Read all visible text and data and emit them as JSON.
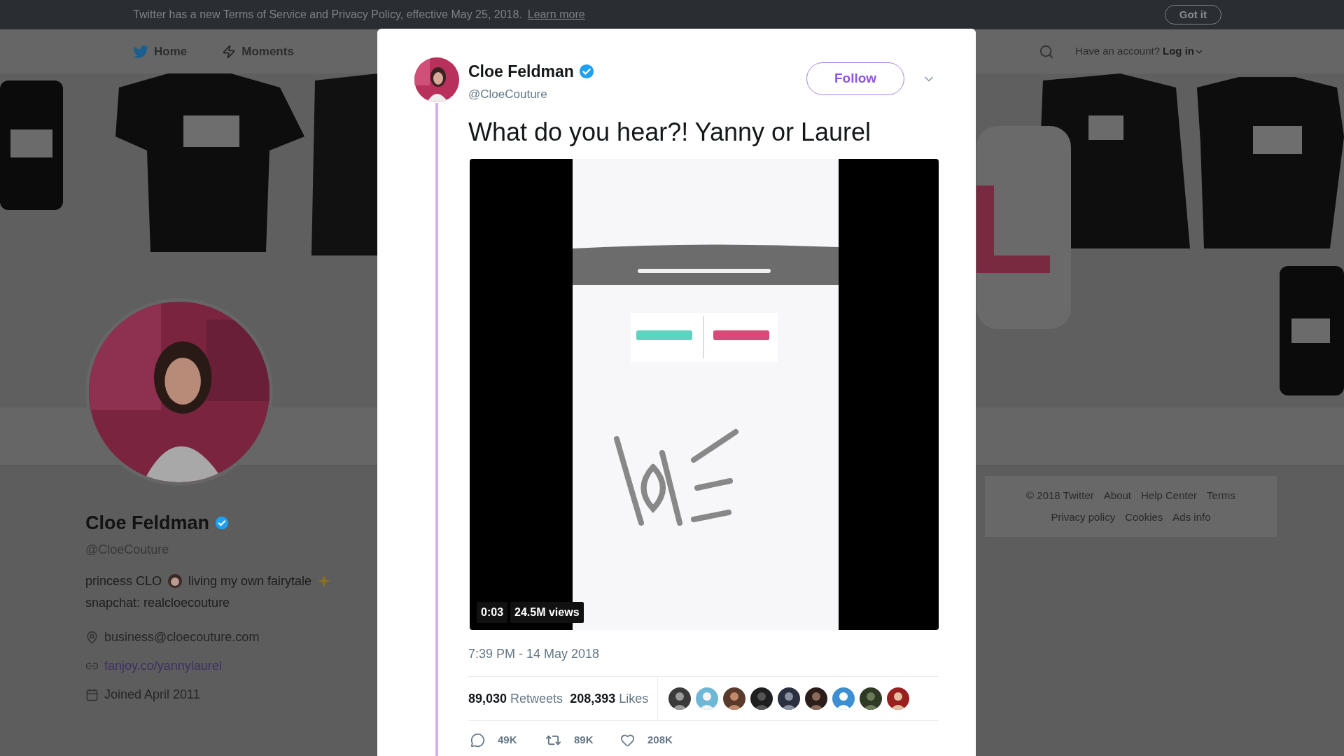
{
  "notice_banner": {
    "text": "Twitter has a new Terms of Service and Privacy Policy, effective May 25, 2018.",
    "link": "Learn more",
    "button": "Got it"
  },
  "nav": {
    "items": [
      {
        "label": "Home",
        "kind": "home"
      },
      {
        "label": "Moments",
        "kind": "moments"
      }
    ],
    "account_prompt": "Have an account?",
    "login": "Log in"
  },
  "profile": {
    "name": "Cloe Feldman",
    "verified": true,
    "handle": "@CloeCouture",
    "bio": {
      "line_1": [
        "princess CLO",
        "living my own fairytale"
      ],
      "line_2": "snapchat: realcloecouture"
    },
    "details": [
      {
        "kind": "location",
        "text": "business@cloecouture.com"
      },
      {
        "kind": "link",
        "text": "fanjoy.co/yannylaurel"
      },
      {
        "kind": "joined",
        "text": "Joined April 2011"
      }
    ]
  },
  "footer": {
    "rows": [
      {
        "links": [
          "© 2018 Twitter",
          "About",
          "Help Center",
          "Terms"
        ]
      },
      {
        "links": [
          "Privacy policy",
          "Cookies",
          "Ads info"
        ]
      }
    ]
  },
  "tweet": {
    "author": {
      "name": "Cloe Feldman",
      "verified": true,
      "handle": "@CloeCouture"
    },
    "follow_button": "Follow",
    "text": "What do you hear?! Yanny or Laurel",
    "video": {
      "duration": "0:03",
      "views": "24.5M views"
    },
    "timestamp": "7:39 PM - 14 May 2018",
    "retweets": {
      "count": "89,030",
      "label": "Retweets"
    },
    "likes": {
      "count": "208,393",
      "label": "Likes"
    },
    "actions": [
      {
        "kind": "reply",
        "count": "49K"
      },
      {
        "kind": "retweet",
        "count": "89K"
      },
      {
        "kind": "like",
        "count": "208K"
      }
    ]
  }
}
